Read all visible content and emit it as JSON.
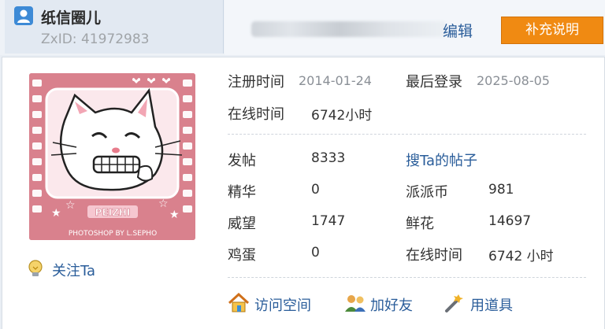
{
  "user": {
    "name": "纸信圈儿",
    "zxid": "ZxID: 41972983"
  },
  "header": {
    "edit_label": "编辑",
    "supplement_label": "补充说明"
  },
  "avatar": {
    "caption": "PEIZHI",
    "credit": "PHOTOSHOP BY L.SEPHO"
  },
  "follow_label": "关注Ta",
  "info": {
    "register_label": "注册时间",
    "register_value": "2014-01-24",
    "lastlogin_label": "最后登录",
    "lastlogin_value": "2025-08-05",
    "online_label": "在线时间",
    "online_value": "6742小时"
  },
  "stats": {
    "posts_label": "发帖",
    "posts_value": "8333",
    "search_posts_link": "搜Ta的帖子",
    "essence_label": "精华",
    "essence_value": "0",
    "coins_label": "派派币",
    "coins_value": "981",
    "prestige_label": "威望",
    "prestige_value": "1747",
    "flowers_label": "鲜花",
    "flowers_value": "14697",
    "eggs_label": "鸡蛋",
    "eggs_value": "0",
    "online2_label": "在线时间",
    "online2_value": "6742 小时"
  },
  "actions": {
    "visit_space": "访问空间",
    "add_friend": "加好友",
    "use_item": "用道具"
  },
  "colors": {
    "accent": "#f08a12",
    "link": "#2a5d9a",
    "avatar_bg": "#d9818d"
  }
}
